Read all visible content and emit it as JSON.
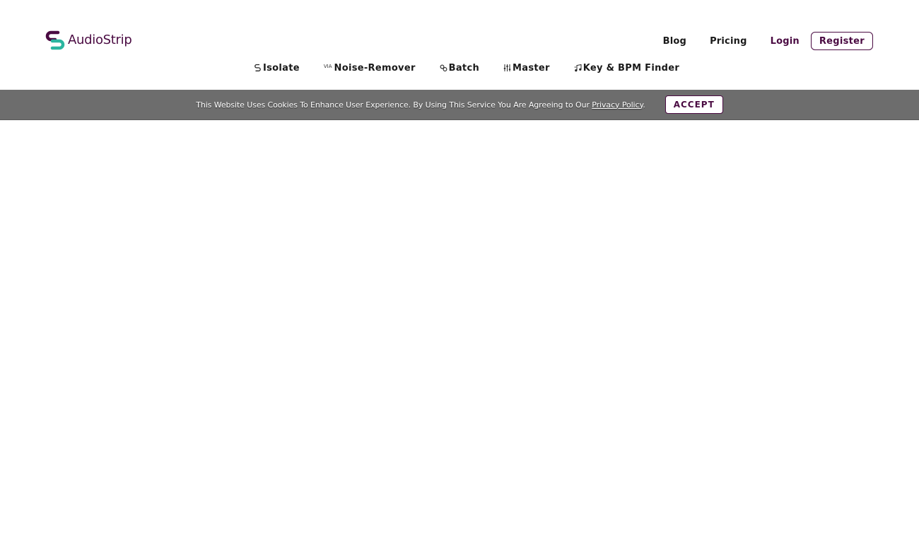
{
  "brand": {
    "name": "AudioStrip",
    "primary_color": "#4a0b42",
    "secondary_color": "#2bb5a0"
  },
  "topnav": {
    "blog": "Blog",
    "pricing": "Pricing",
    "login": "Login",
    "register": "Register"
  },
  "tools": [
    {
      "label": "Isolate",
      "icon": "strip-s-icon"
    },
    {
      "label": "Noise-Remover",
      "icon": "via-icon",
      "icon_text": "VIA"
    },
    {
      "label": "Batch",
      "icon": "link-icon"
    },
    {
      "label": "Master",
      "icon": "equalizer-icon"
    },
    {
      "label": "Key & BPM Finder",
      "icon": "music-note-icon"
    }
  ],
  "cookie_banner": {
    "message": "This Website Uses Cookies To Enhance User Experience. By Using This Service You Are Agreeing to Our ",
    "link_text": "Privacy Policy",
    "trailing": ".",
    "accept_label": "ACCEPT",
    "background": "#6d6d6d"
  }
}
